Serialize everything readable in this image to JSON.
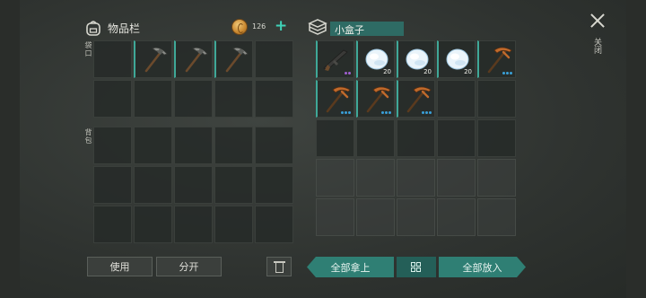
{
  "inventory": {
    "title": "物品栏",
    "icon": "backpack-icon",
    "coins": "126",
    "add_label": "+",
    "pocket_label": "袋口",
    "backpack_label": "背包"
  },
  "container": {
    "title": "小盒子",
    "icon": "box-icon",
    "slots": [
      {
        "item": "rifle",
        "qty": "",
        "dots": [
          "#a060d0",
          "#a060d0"
        ]
      },
      {
        "item": "snowball",
        "qty": "20",
        "dots": []
      },
      {
        "item": "snowball",
        "qty": "20",
        "dots": []
      },
      {
        "item": "snowball",
        "qty": "20",
        "dots": []
      },
      {
        "item": "copper-pickaxe",
        "qty": "",
        "dots": [
          "#3aa0d8",
          "#3aa0d8",
          "#3aa0d8"
        ]
      },
      {
        "item": "copper-pickaxe",
        "qty": "",
        "dots": [
          "#3aa0d8",
          "#3aa0d8",
          "#3aa0d8"
        ]
      },
      {
        "item": "copper-pickaxe",
        "qty": "",
        "dots": [
          "#3aa0d8",
          "#3aa0d8",
          "#3aa0d8"
        ]
      },
      {
        "item": "copper-pickaxe",
        "qty": "",
        "dots": [
          "#3aa0d8",
          "#3aa0d8",
          "#3aa0d8"
        ]
      }
    ]
  },
  "close": {
    "label": "关闭"
  },
  "actions": {
    "use": "使用",
    "split": "分开",
    "take_all": "全部拿上",
    "put_all": "全部放入"
  },
  "hotbar_items": [
    "stone-pickaxe",
    "stone-pickaxe",
    "stone-pickaxe"
  ],
  "colors": {
    "accent": "#2f7f74",
    "teal_text": "#3fd2b8"
  }
}
